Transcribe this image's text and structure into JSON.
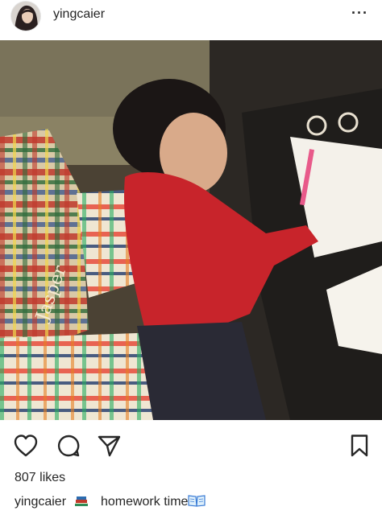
{
  "post": {
    "username": "yingcaier",
    "more_label": "···",
    "likes": "807 likes",
    "caption_user": "yingcaier",
    "caption_text": "homework time",
    "photo_text": "Jasper"
  },
  "icons": {
    "header": [
      "avatar",
      "more-icon"
    ],
    "actions": [
      "heart-icon",
      "comment-icon",
      "share-icon",
      "bookmark-icon"
    ],
    "caption": [
      "books-emoji-icon",
      "open-book-emoji-icon"
    ]
  },
  "colors": {
    "text": "#262626",
    "background": "#ffffff"
  }
}
